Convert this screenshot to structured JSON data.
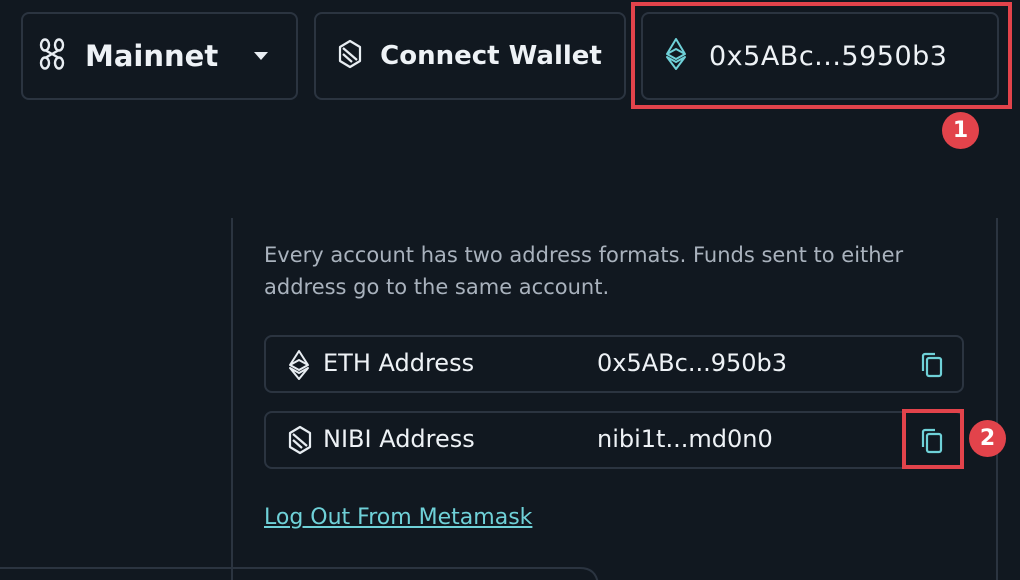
{
  "header": {
    "network": {
      "label": "Mainnet",
      "icon": "chain-link-icon",
      "caret_icon": "caret-down-icon"
    },
    "connect": {
      "label": "Connect Wallet",
      "icon": "nibiru-logo-icon"
    },
    "account": {
      "address": "0x5ABc...5950b3",
      "icon": "ethereum-icon"
    }
  },
  "panel": {
    "description": "Every account has two address formats. Funds sent to either address go to the same account.",
    "rows": [
      {
        "label": "ETH Address",
        "value": "0x5ABc...950b3",
        "icon": "ethereum-icon",
        "action_icon": "copy-icon"
      },
      {
        "label": "NIBI Address",
        "value": "nibi1t...md0n0",
        "icon": "nibiru-logo-icon",
        "action_icon": "copy-icon"
      }
    ],
    "logout_label": "Log Out From Metamask"
  },
  "annotations": [
    "1",
    "2"
  ],
  "colors": {
    "background": "#111820",
    "border": "#2b3440",
    "accent": "#6fd1d8",
    "annotation": "#e2434b",
    "muted_text": "#a9b2bd"
  }
}
